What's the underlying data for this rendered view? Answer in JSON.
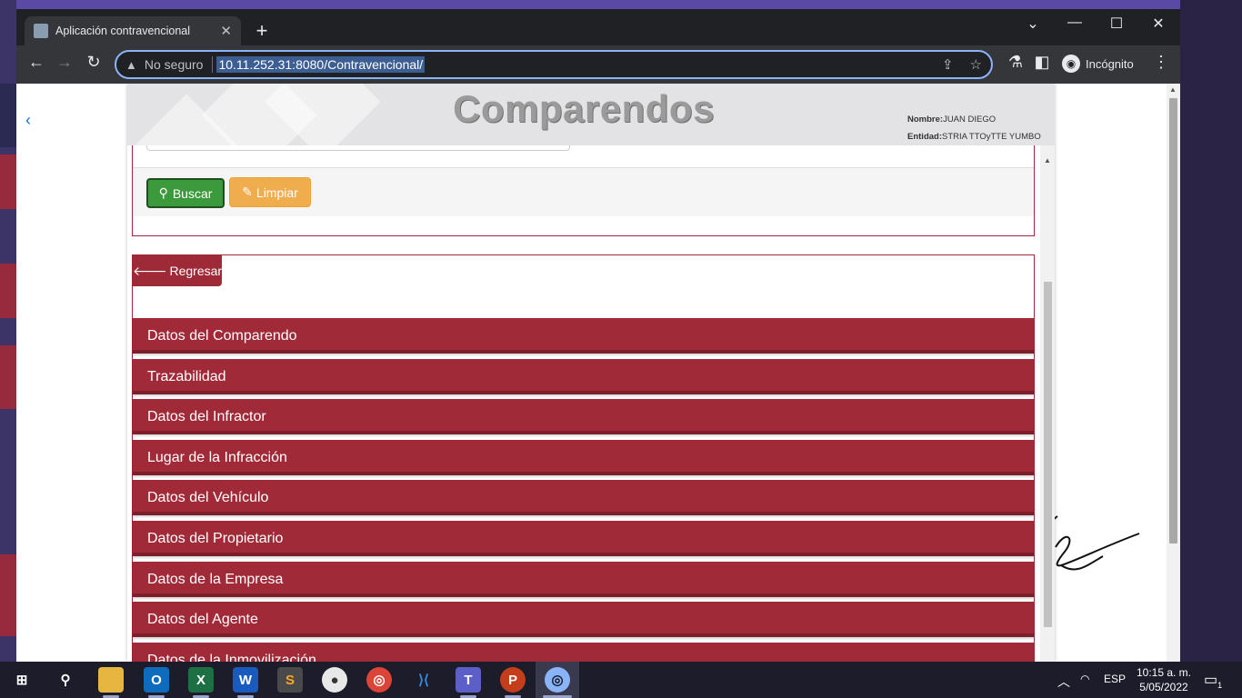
{
  "browser": {
    "tab_title": "Aplicación contravencional",
    "security_label": "No seguro",
    "url": "10.11.252.31:8080/Contravencional/",
    "profile_label": "Incógnito"
  },
  "app": {
    "title": "Comparendos",
    "user": {
      "nombre_label": "Nombre:",
      "nombre_value": "JUAN DIEGO",
      "entidad_label": "Entidad:",
      "entidad_value": "STRIA TTOyTTE YUMBO"
    },
    "filter": {
      "buscar_label": "Buscar",
      "limpiar_label": "Limpiar"
    },
    "detail": {
      "regresar_label": "Regresar",
      "sections": [
        "Datos del Comparendo",
        "Trazabilidad",
        "Datos del Infractor",
        "Lugar de la Infracción",
        "Datos del Vehículo",
        "Datos del Propietario",
        "Datos de la Empresa",
        "Datos del Agente",
        "Datos de la Inmovilización"
      ]
    }
  },
  "taskbar": {
    "language": "ESP",
    "time": "10:15 a. m.",
    "date": "5/05/2022",
    "notification_count": "1",
    "apps": [
      "file-explorer",
      "outlook",
      "excel",
      "word",
      "sublime-text",
      "app-icon",
      "chrome",
      "vscode",
      "teams",
      "powerpoint",
      "chrome-incognito"
    ]
  },
  "colors": {
    "section_bg": "#a12a38",
    "buscar_bg": "#3c9a3c",
    "limpiar_bg": "#f0ad4e",
    "accent_url": "#8ab4f8"
  }
}
